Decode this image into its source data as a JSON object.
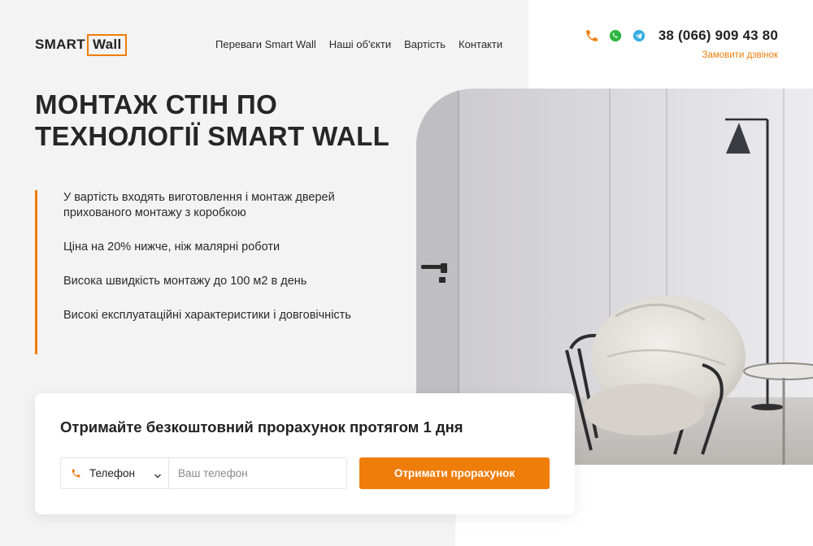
{
  "brand": {
    "logo_part1": "SMART",
    "logo_part2": "Wall",
    "accent": "#ef7d0a"
  },
  "nav": {
    "items": [
      {
        "label": "Переваги Smart Wall"
      },
      {
        "label": "Наші об'єкти"
      },
      {
        "label": "Вартість"
      },
      {
        "label": "Контакти"
      }
    ]
  },
  "contacts": {
    "icons": [
      "phone-icon",
      "whatsapp-icon",
      "telegram-icon"
    ],
    "phone": "38 (066) 909 43 80",
    "callback": "Замовити дзвінок"
  },
  "hero": {
    "title": "Монтаж стін по технології Smart Wall",
    "features": [
      "У вартість входять виготовлення і монтаж дверей прихованого монтажу з коробкою",
      "Ціна на 20% нижче, ніж малярні роботи",
      "Висока швидкість монтажу до 100 м2 в день",
      "Високі експлуатаційні характеристики і довговічність"
    ],
    "image": "interior-photo"
  },
  "form": {
    "title": "Отримайте безкоштовний прорахунок протягом 1 дня",
    "contact_type": "Телефон",
    "phone_placeholder": "Ваш телефон",
    "submit_label": "Отримати прорахунок"
  }
}
